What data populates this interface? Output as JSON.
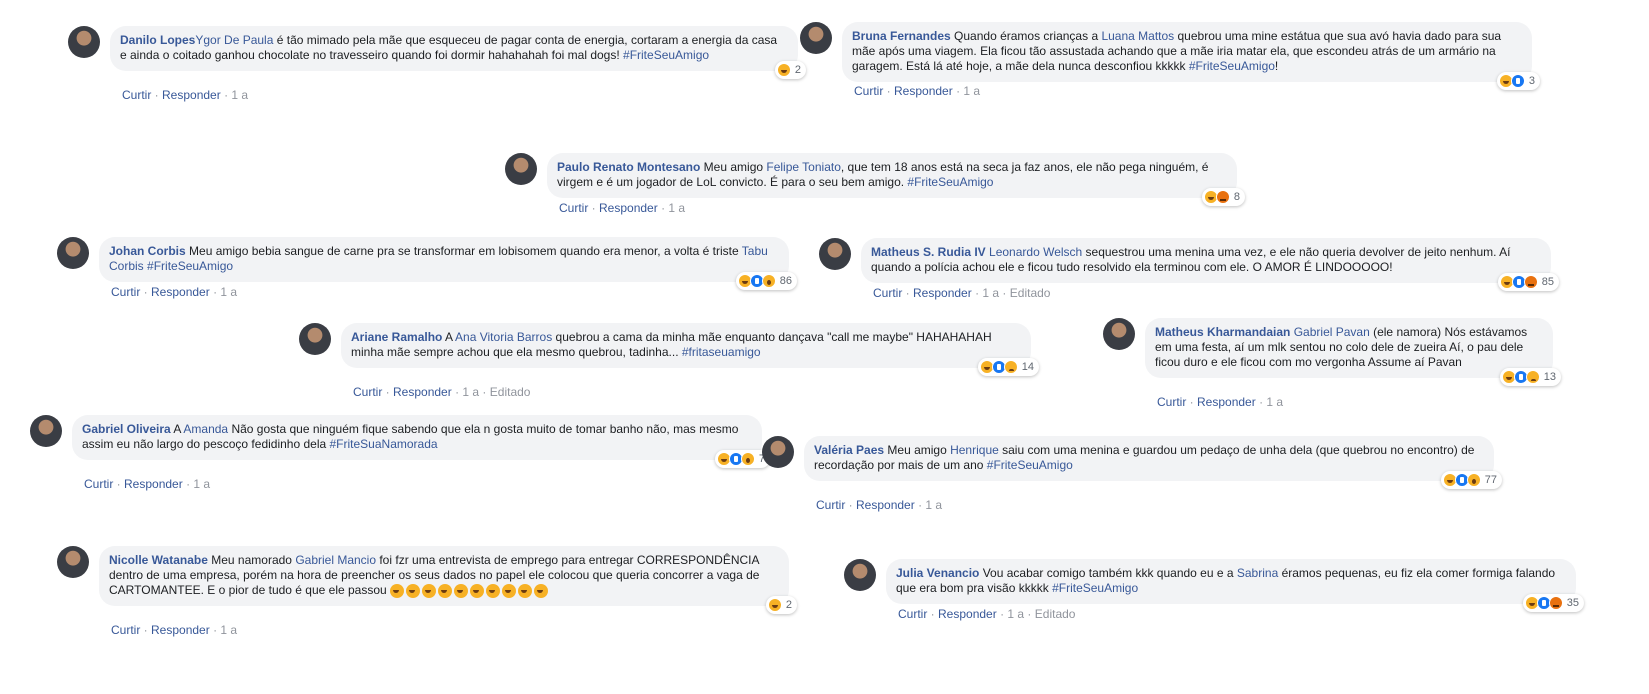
{
  "comments": [
    {
      "name": "Danilo Lopes",
      "parts": [
        {
          "t": "tag",
          "v": "Ygor De Paula"
        },
        {
          "t": "text",
          "v": " é tão mimado pela mãe que esqueceu de pagar conta de energia, cortaram a energia da casa e ainda o coitado ganhou chocolate no travesseiro quando foi dormir hahahahah foi mal dogs! "
        },
        {
          "t": "tag",
          "v": "#FriteSeuAmigo"
        }
      ],
      "actions": {
        "like": "Curtir",
        "reply": "Responder",
        "age": "1 a",
        "edited": ""
      },
      "reactions": {
        "types": [
          "haha"
        ],
        "count": "2"
      }
    },
    {
      "name": "Bruna Fernandes",
      "parts": [
        {
          "t": "text",
          "v": " Quando éramos crianças a "
        },
        {
          "t": "tag",
          "v": "Luana Mattos"
        },
        {
          "t": "text",
          "v": " quebrou uma mine estátua que sua avó havia dado para sua mãe após uma viagem. Ela ficou tão assustada achando que a mãe iria matar ela, que escondeu atrás de um armário na garagem. Está lá até hoje, a mãe dela nunca desconfiou kkkkk "
        },
        {
          "t": "tag",
          "v": "#FriteSeuAmigo"
        },
        {
          "t": "text",
          "v": "!"
        }
      ],
      "actions": {
        "like": "Curtir",
        "reply": "Responder",
        "age": "1 a",
        "edited": ""
      },
      "reactions": {
        "types": [
          "haha",
          "like"
        ],
        "count": "3"
      }
    },
    {
      "name": "Paulo Renato Montesano",
      "parts": [
        {
          "t": "text",
          "v": " Meu amigo "
        },
        {
          "t": "tag",
          "v": "Felipe Toniato"
        },
        {
          "t": "text",
          "v": ", que tem 18 anos está na seca ja faz anos, ele não pega ninguém, é virgem e é um jogador de LoL convicto. É para o seu bem amigo. "
        },
        {
          "t": "tag",
          "v": "#FriteSeuAmigo"
        }
      ],
      "actions": {
        "like": "Curtir",
        "reply": "Responder",
        "age": "1 a",
        "edited": ""
      },
      "reactions": {
        "types": [
          "haha",
          "angry"
        ],
        "count": "8"
      }
    },
    {
      "name": "Johan Corbis",
      "parts": [
        {
          "t": "text",
          "v": " Meu amigo bebia sangue de carne pra se transformar em lobisomem quando era menor, a volta é triste "
        },
        {
          "t": "tag",
          "v": "Tabu Corbis"
        },
        {
          "t": "text",
          "v": " "
        },
        {
          "t": "tag",
          "v": "#FriteSeuAmigo"
        }
      ],
      "actions": {
        "like": "Curtir",
        "reply": "Responder",
        "age": "1 a",
        "edited": ""
      },
      "reactions": {
        "types": [
          "haha",
          "like",
          "wow"
        ],
        "count": "86"
      }
    },
    {
      "name": "Matheus S. Rudia IV",
      "parts": [
        {
          "t": "text",
          "v": " "
        },
        {
          "t": "tag",
          "v": "Leonardo Welsch"
        },
        {
          "t": "text",
          "v": " sequestrou uma menina uma vez, e ele não queria devolver de jeito nenhum. Aí quando a polícia achou ele e ficou tudo resolvido ela terminou com ele. O AMOR É LINDOOOOO!"
        }
      ],
      "actions": {
        "like": "Curtir",
        "reply": "Responder",
        "age": "1 a",
        "edited": "Editado"
      },
      "reactions": {
        "types": [
          "haha",
          "like",
          "angry"
        ],
        "count": "85"
      }
    },
    {
      "name": "Ariane Ramalho",
      "parts": [
        {
          "t": "text",
          "v": " A "
        },
        {
          "t": "tag",
          "v": "Ana Vitoria Barros"
        },
        {
          "t": "text",
          "v": " quebrou a cama da minha mãe enquanto dançava \"call me maybe\" HAHAHAHAH minha mãe sempre achou que ela mesmo quebrou, tadinha... "
        },
        {
          "t": "tag",
          "v": "#fritaseuamigo"
        }
      ],
      "actions": {
        "like": "Curtir",
        "reply": "Responder",
        "age": "1 a",
        "edited": "Editado"
      },
      "reactions": {
        "types": [
          "haha",
          "like",
          "sad"
        ],
        "count": "14"
      }
    },
    {
      "name": "Matheus Kharmandaian",
      "parts": [
        {
          "t": "text",
          "v": " "
        },
        {
          "t": "tag",
          "v": "Gabriel Pavan"
        },
        {
          "t": "text",
          "v": " (ele namora) Nós estávamos em uma festa, aí um mlk sentou no colo dele de zueira Aí, o pau dele ficou duro e ele ficou com mo vergonha Assume aí Pavan"
        }
      ],
      "actions": {
        "like": "Curtir",
        "reply": "Responder",
        "age": "1 a",
        "edited": ""
      },
      "reactions": {
        "types": [
          "haha",
          "like",
          "sad"
        ],
        "count": "13"
      }
    },
    {
      "name": "Gabriel Oliveira",
      "parts": [
        {
          "t": "text",
          "v": " A "
        },
        {
          "t": "tag",
          "v": "Amanda"
        },
        {
          "t": "text",
          "v": " Não gosta que ninguém fique sabendo que ela n gosta muito de tomar banho não, mas mesmo assim eu não largo do pescoço fedidinho dela "
        },
        {
          "t": "tag",
          "v": "#FriteSuaNamorada"
        }
      ],
      "actions": {
        "like": "Curtir",
        "reply": "Responder",
        "age": "1 a",
        "edited": ""
      },
      "reactions": {
        "types": [
          "haha",
          "like",
          "wow"
        ],
        "count": "7"
      }
    },
    {
      "name": "Valéria Paes",
      "parts": [
        {
          "t": "text",
          "v": " Meu amigo "
        },
        {
          "t": "tag",
          "v": "Henrique"
        },
        {
          "t": "text",
          "v": " saiu com uma menina e guardou um pedaço de unha dela (que quebrou no encontro) de recordação por mais de um ano "
        },
        {
          "t": "tag",
          "v": "#FriteSeuAmigo"
        }
      ],
      "actions": {
        "like": "Curtir",
        "reply": "Responder",
        "age": "1 a",
        "edited": ""
      },
      "reactions": {
        "types": [
          "haha",
          "like",
          "wow"
        ],
        "count": "77"
      }
    },
    {
      "name": "Nicolle Watanabe",
      "parts": [
        {
          "t": "text",
          "v": " Meu namorado "
        },
        {
          "t": "tag",
          "v": "Gabriel Mancio"
        },
        {
          "t": "text",
          "v": " foi fzr uma entrevista de emprego para entregar CORRESPONDÊNCIA dentro de uma empresa, porém na hora de preencher os seus dados no papel ele colocou que queria concorrer a vaga de CARTOMANTEE. E o pior de tudo é que ele passou "
        }
      ],
      "emoji_run": 10,
      "actions": {
        "like": "Curtir",
        "reply": "Responder",
        "age": "1 a",
        "edited": ""
      },
      "reactions": {
        "types": [
          "haha"
        ],
        "count": "2"
      }
    },
    {
      "name": "Julia Venancio",
      "parts": [
        {
          "t": "text",
          "v": " Vou acabar comigo também kkk quando eu e a "
        },
        {
          "t": "tag",
          "v": "Sabrina"
        },
        {
          "t": "text",
          "v": " éramos pequenas, eu fiz ela comer formiga falando que era bom pra visão kkkkk "
        },
        {
          "t": "tag",
          "v": "#FriteSeuAmigo"
        }
      ],
      "actions": {
        "like": "Curtir",
        "reply": "Responder",
        "age": "1 a",
        "edited": "Editado"
      },
      "reactions": {
        "types": [
          "haha",
          "like",
          "angry"
        ],
        "count": "35"
      }
    }
  ],
  "colors": {
    "link": "#385898",
    "bubble": "#f2f3f5",
    "muted": "#90949c"
  }
}
